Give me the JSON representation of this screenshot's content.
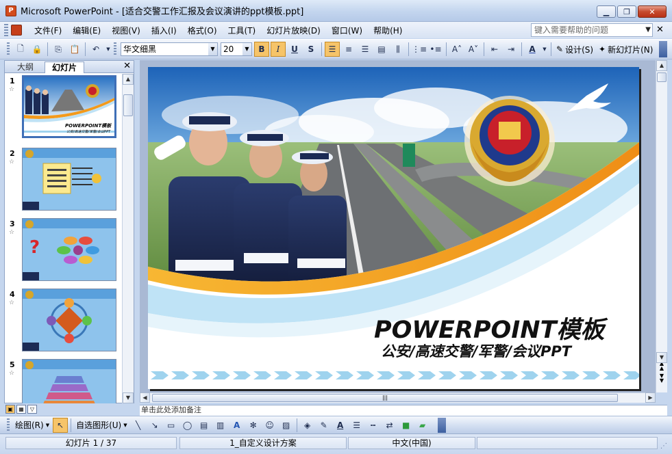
{
  "window": {
    "title": "Microsoft PowerPoint - [适合交警工作汇报及会议演讲的ppt模板.ppt]",
    "app_icon_letter": "P"
  },
  "menu": {
    "items": [
      "文件(F)",
      "编辑(E)",
      "视图(V)",
      "插入(I)",
      "格式(O)",
      "工具(T)",
      "幻灯片放映(D)",
      "窗口(W)",
      "帮助(H)"
    ],
    "help_placeholder": "键入需要帮助的问题"
  },
  "toolbar": {
    "font_name": "华文细黑",
    "font_size": "20",
    "bold": "B",
    "italic": "I",
    "underline": "U",
    "shadow": "S",
    "design_label": "设计(S)",
    "new_slide_label": "新幻灯片(N)"
  },
  "left_pane": {
    "tab_outline": "大纲",
    "tab_slides": "幻灯片",
    "slides": [
      {
        "number": "1",
        "title": "POWERPOINT模板",
        "subtitle": "公安/高速交警/军警/会议PPT"
      },
      {
        "number": "2"
      },
      {
        "number": "3"
      },
      {
        "number": "4"
      },
      {
        "number": "5"
      }
    ]
  },
  "slide": {
    "title": "POWERPOINT模板",
    "subtitle": "公安/高速交警/军警/会议PPT"
  },
  "notes": {
    "placeholder": "单击此处添加备注"
  },
  "drawbar": {
    "draw_label": "绘图(R)",
    "autoshapes_label": "自选图形(U)"
  },
  "status": {
    "slide_position": "幻灯片 1 / 37",
    "design": "1_自定义设计方案",
    "language": "中文(中国)"
  },
  "colors": {
    "accent_blue": "#3f6fb7",
    "active_button": "#f6c469",
    "slide_orange": "#f39a1c"
  }
}
